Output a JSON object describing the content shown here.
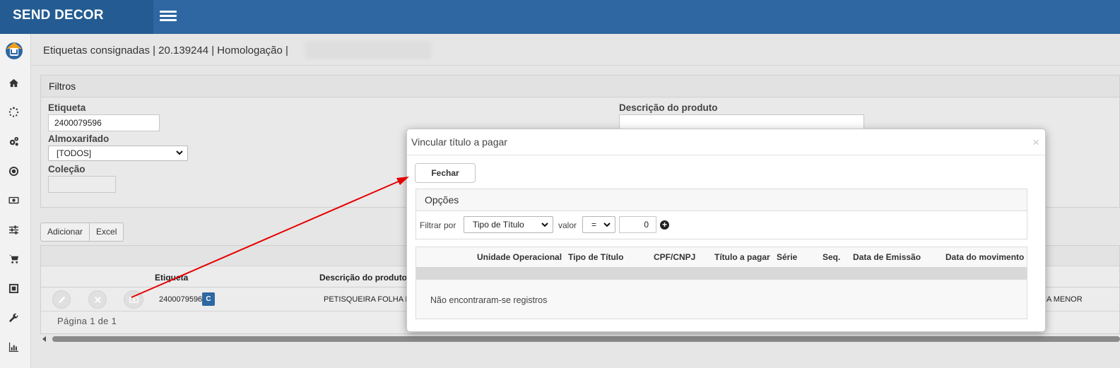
{
  "app": {
    "brand": "SEND DECOR"
  },
  "header": {
    "breadcrumb": "Etiquetas consignadas | 20.139244 | Homologação |"
  },
  "sidebar": {
    "icons": [
      "home-icon",
      "spinner-icon",
      "gears-icon",
      "target-icon",
      "money-icon",
      "sliders-icon",
      "cart-icon",
      "picture-frame-icon",
      "wrench-icon",
      "bar-chart-icon"
    ]
  },
  "filters": {
    "title": "Filtros",
    "etiqueta_label": "Etiqueta",
    "etiqueta_value": "2400079596",
    "almoxarifado_label": "Almoxarifado",
    "almoxarifado_value": "[TODOS]",
    "colecao_label": "Coleção",
    "descricao_label": "Descrição do produto"
  },
  "toolbar": {
    "adicionar": "Adicionar",
    "excel": "Excel"
  },
  "grid": {
    "columns": [
      "Etiqueta",
      "Descrição do produto"
    ],
    "row": {
      "etiqueta": "2400079596",
      "badge": "C",
      "descricao": "PETISQUEIRA FOLHA EM J",
      "right_cell": "CA MENOR"
    },
    "pager": "Página 1 de 1"
  },
  "modal": {
    "title": "Vincular título a pagar",
    "close": "×",
    "fechar": "Fechar",
    "opcoes_title": "Opções",
    "filtrar_por": "Filtrar por",
    "filter_field": "Tipo de Título",
    "valor_label": "valor",
    "operator": "=",
    "value": "0",
    "columns": [
      "Unidade Operacional",
      "Tipo de Título",
      "CPF/CNPJ",
      "Título a pagar",
      "Série",
      "Seq.",
      "Data de Emissão",
      "Data do movimento"
    ],
    "empty": "Não encontraram-se registros"
  },
  "colors": {
    "topbar": "#2e67a1",
    "brand_bg": "#245b92",
    "annotation_arrow": "#e60000"
  }
}
